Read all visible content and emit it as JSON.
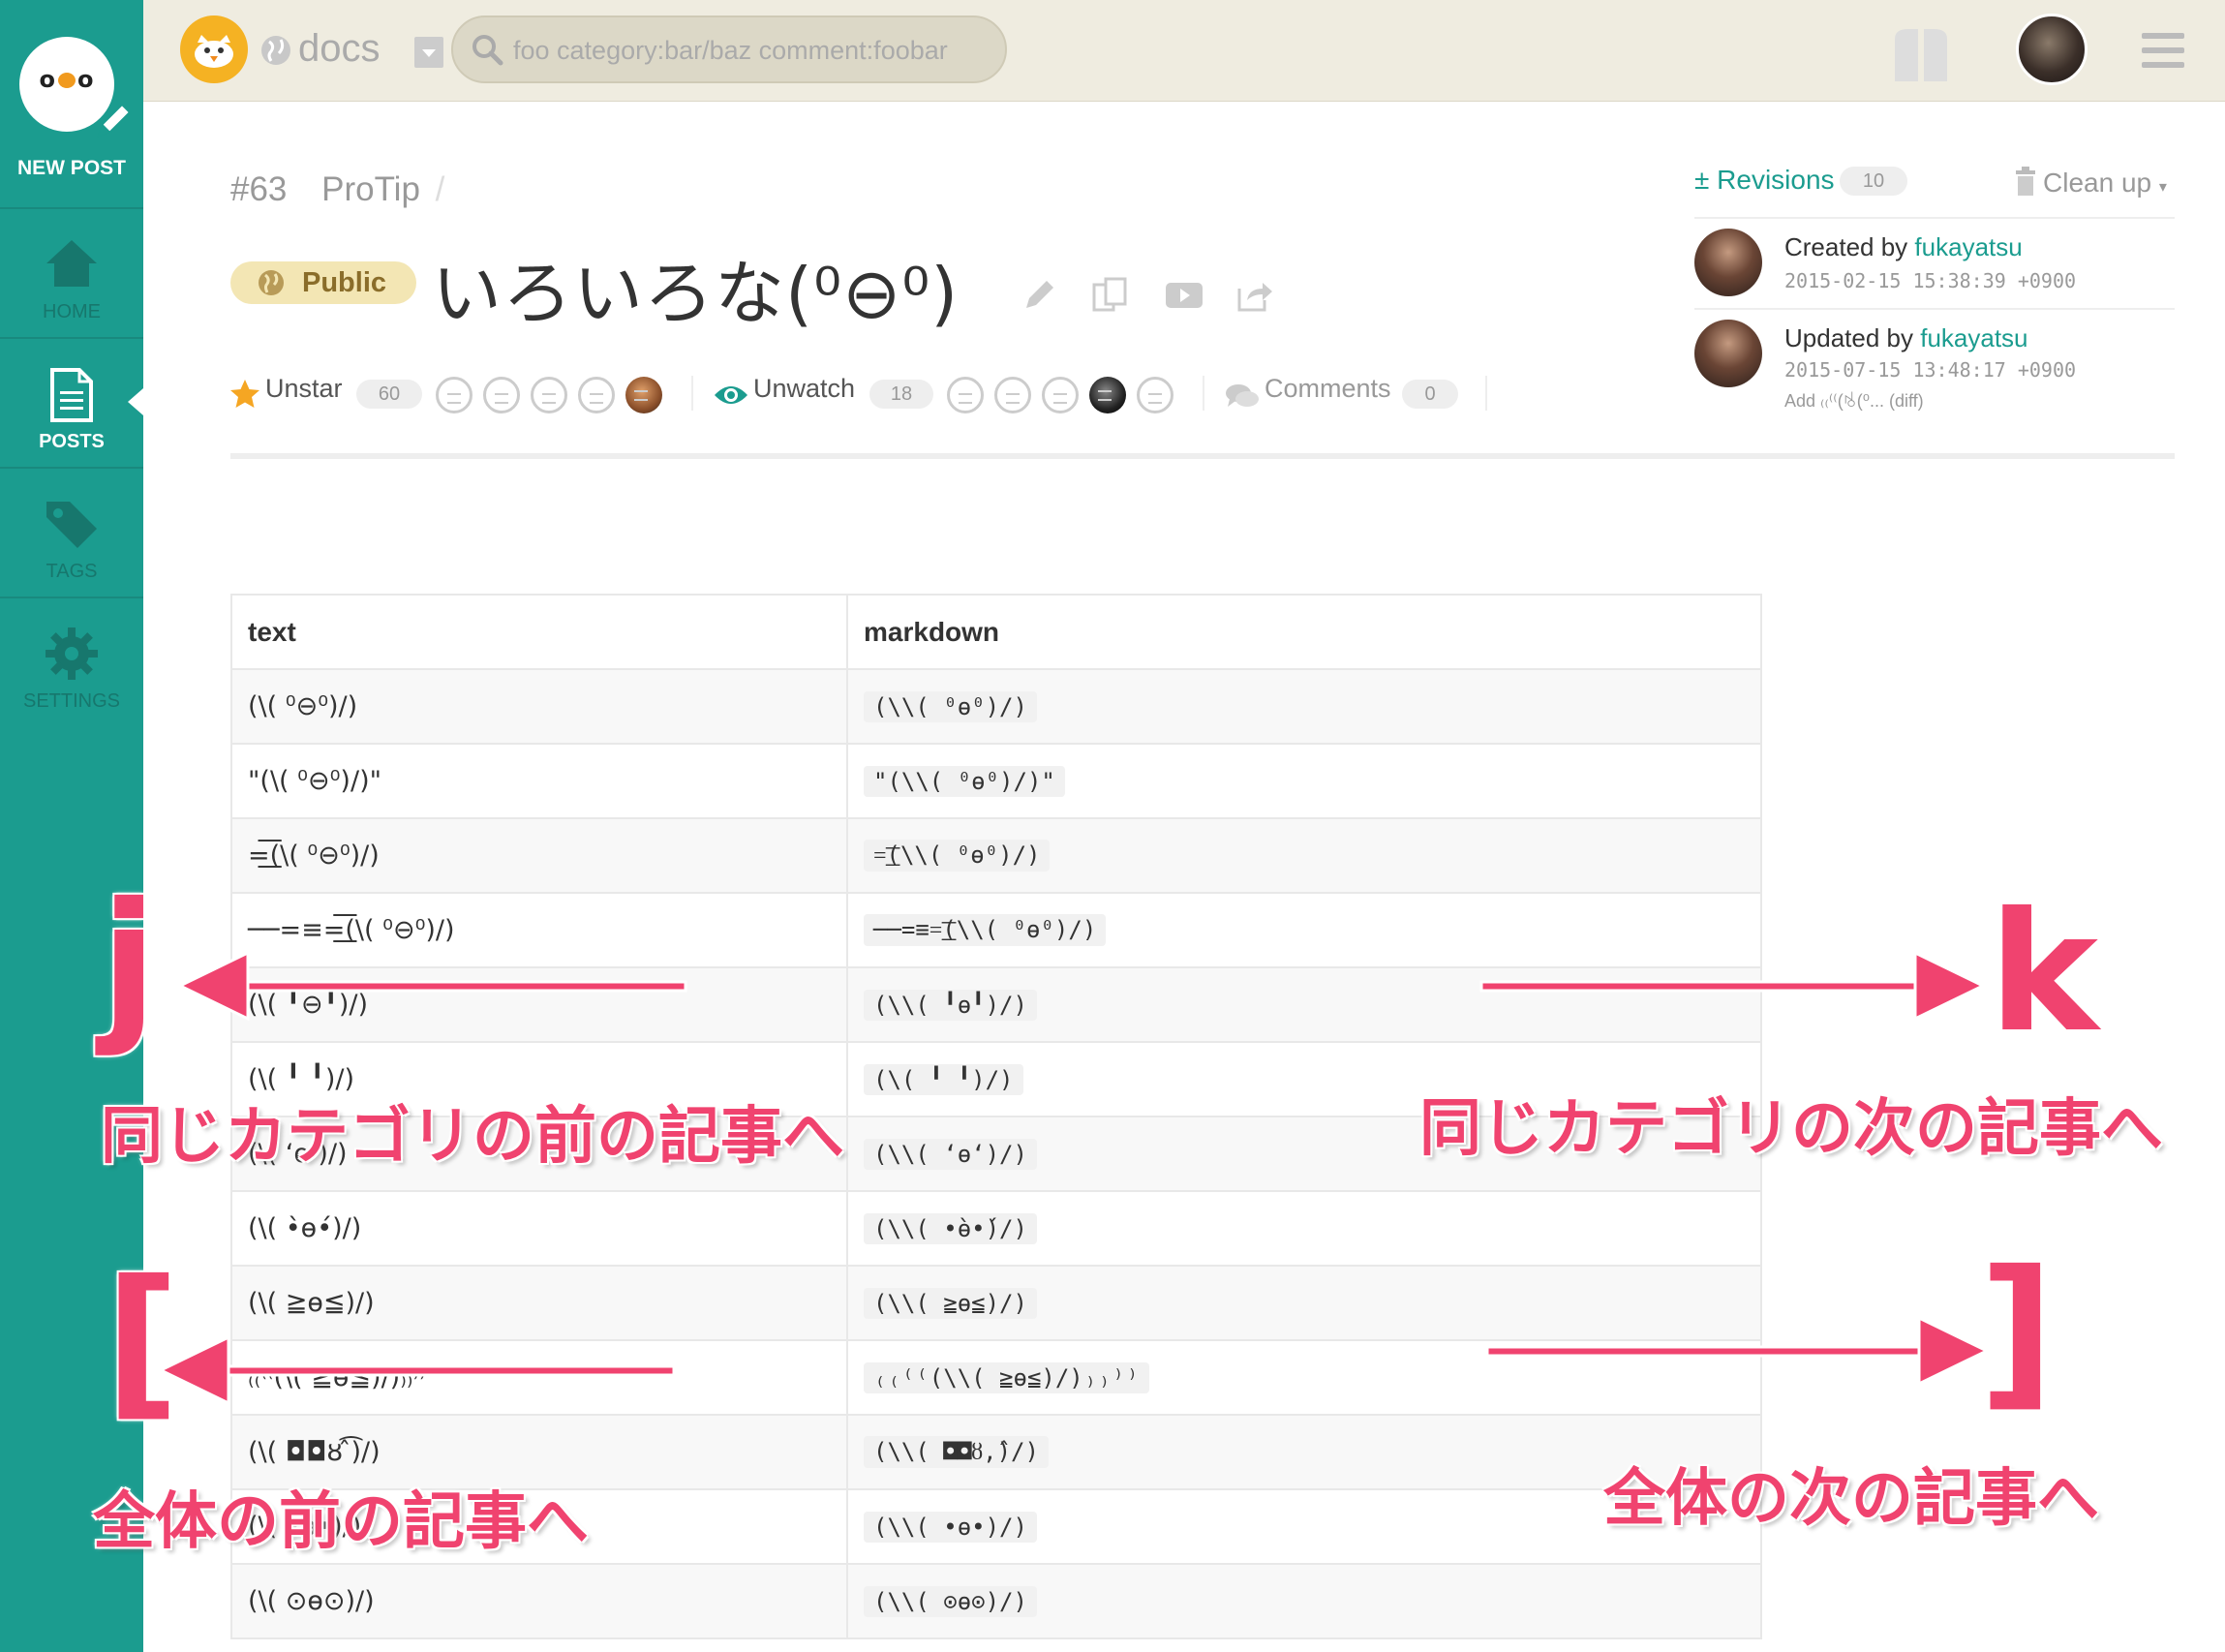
{
  "sidebar": {
    "logo_text": "oo",
    "new_post": "NEW POST",
    "items": [
      {
        "label": "HOME",
        "icon": "home-icon"
      },
      {
        "label": "POSTS",
        "icon": "document-icon"
      },
      {
        "label": "TAGS",
        "icon": "tag-icon"
      },
      {
        "label": "SETTINGS",
        "icon": "gear-icon"
      }
    ]
  },
  "topbar": {
    "team_name": "docs",
    "search_placeholder": "foo category:bar/baz comment:foobar"
  },
  "post": {
    "number": "#63",
    "category": "ProTip",
    "separator": "/",
    "visibility": "Public",
    "title": "いろいろな(⁰⊖⁰)"
  },
  "meta": {
    "star_label": "Unstar",
    "star_count": "60",
    "watch_label": "Unwatch",
    "watch_count": "18",
    "comments_label": "Comments",
    "comments_count": "0"
  },
  "panel": {
    "revisions_label": "Revisions",
    "revisions_count": "10",
    "cleanup_label": "Clean up",
    "created_prefix": "Created by",
    "created_user": "fukayatsu",
    "created_date": "2015-02-15 15:38:39 +0900",
    "updated_prefix": "Updated by",
    "updated_user": "fukayatsu",
    "updated_date": "2015-07-15 13:48:17 +0900",
    "updated_note": "Add ₍₍⁽⁽(ꂚ(⁰... (diff)"
  },
  "table": {
    "headers": [
      "text",
      "markdown"
    ],
    "rows": [
      {
        "text": "(\\( ⁰⊖⁰)/)",
        "markdown": "(\\\\( ⁰ɵ⁰)/)"
      },
      {
        "text": "\"(\\( ⁰⊖⁰)/)\"",
        "markdown": "\"(\\\\( ⁰ɵ⁰)/)\""
      },
      {
        "text": "=͟͟͞͞(\\( ⁰⊖⁰)/)",
        "markdown": "=͟͟͞͞(\\\\( ⁰ɵ⁰)/)"
      },
      {
        "text": "──=≡=͟͟͞͞(\\( ⁰⊖⁰)/)",
        "markdown": "──=≡=͟͟͞͞(\\\\( ⁰ɵ⁰)/)"
      },
      {
        "text": "(\\( ╹⊖╹)/)",
        "markdown": "(\\\\( ╹ɵ╹)/)"
      },
      {
        "text": "(\\( ╹ ╹)/)",
        "markdown": "(\\( ╹ ╹)/)"
      },
      {
        "text": "(\\( ‘ɵ‘)/)",
        "markdown": "(\\\\( ‘ɵ‘)/)"
      },
      {
        "text": "(\\( •̀ɵ•́)/)",
        "markdown": "(\\\\( •̀ɵ•́)/)"
      },
      {
        "text": "(\\( ≧ɵ≦)/)",
        "markdown": "(\\\\( ≧ɵ≦)/)"
      },
      {
        "text": "₍₍⁽⁽(\\( ≧ɵ≦)/)₎₎⁾⁾",
        "markdown": "₍₍⁽⁽(\\\\( ≧ɵ≦)/)₎₎⁾⁾"
      },
      {
        "text": "(\\( ◘◘ȣ ̂͡)/)",
        "markdown": "(\\\\( ◘◘ȣ‚̂)/)"
      },
      {
        "text": "(\\( •ɵ•)/)",
        "markdown": "(\\\\( •ɵ•)/)"
      },
      {
        "text": "(\\( ⊙ɵ⊙)/)",
        "markdown": "(\\\\( ⊙ɵ⊙)/)"
      }
    ]
  },
  "annotations": {
    "j_key": "j",
    "k_key": "k",
    "prev_all_key": "[",
    "next_all_key": "]",
    "j_text": "同じカテゴリの前の記事へ",
    "k_text": "同じカテゴリの次の記事へ",
    "prev_all_text": "全体の前の記事へ",
    "next_all_text": "全体の次の記事へ",
    "color": "#f0436f"
  },
  "colors": {
    "sidebar": "#1b9c8f",
    "topbar": "#efece0",
    "accent": "#1b9c8f"
  }
}
